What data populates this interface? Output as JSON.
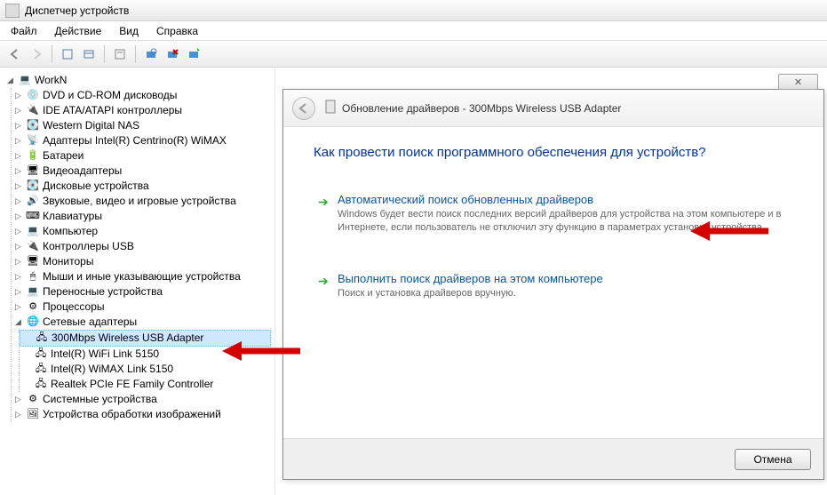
{
  "window_title": "Диспетчер устройств",
  "menus": [
    "Файл",
    "Действие",
    "Вид",
    "Справка"
  ],
  "root_node": "WorkN",
  "categories": [
    {
      "icon": "💿",
      "label": "DVD и CD-ROM дисководы"
    },
    {
      "icon": "🔌",
      "label": "IDE ATA/ATAPI контроллеры"
    },
    {
      "icon": "💽",
      "label": "Western Digital NAS"
    },
    {
      "icon": "📡",
      "label": "Адаптеры Intel(R) Centrino(R) WiMAX"
    },
    {
      "icon": "🔋",
      "label": "Батареи"
    },
    {
      "icon": "🖥",
      "label": "Видеоадаптеры"
    },
    {
      "icon": "💽",
      "label": "Дисковые устройства"
    },
    {
      "icon": "🔊",
      "label": "Звуковые, видео и игровые устройства"
    },
    {
      "icon": "⌨",
      "label": "Клавиатуры"
    },
    {
      "icon": "💻",
      "label": "Компьютер"
    },
    {
      "icon": "🔌",
      "label": "Контроллеры USB"
    },
    {
      "icon": "🖥",
      "label": "Мониторы"
    },
    {
      "icon": "🖱",
      "label": "Мыши и иные указывающие устройства"
    },
    {
      "icon": "💻",
      "label": "Переносные устройства"
    },
    {
      "icon": "⚙",
      "label": "Процессоры"
    }
  ],
  "network_category": {
    "icon": "🌐",
    "label": "Сетевые адаптеры"
  },
  "network_items": [
    "300Mbps Wireless USB Adapter",
    "Intel(R) WiFi Link 5150",
    "Intel(R) WiMAX Link 5150",
    "Realtek PCIe FE Family Controller"
  ],
  "tail_categories": [
    {
      "icon": "⚙",
      "label": "Системные устройства"
    },
    {
      "icon": "🖼",
      "label": "Устройства обработки изображений"
    }
  ],
  "dialog": {
    "title": "Обновление драйверов - 300Mbps Wireless USB Adapter",
    "question": "Как провести поиск программного обеспечения для устройств?",
    "option1_title": "Автоматический поиск обновленных драйверов",
    "option1_desc": "Windows будет вести поиск последних версий драйверов для устройства на этом компьютере и в Интернете, если пользователь не отключил эту функцию в параметрах установки устройства.",
    "option2_title": "Выполнить поиск драйверов на этом компьютере",
    "option2_desc": "Поиск и установка драйверов вручную.",
    "cancel": "Отмена"
  }
}
